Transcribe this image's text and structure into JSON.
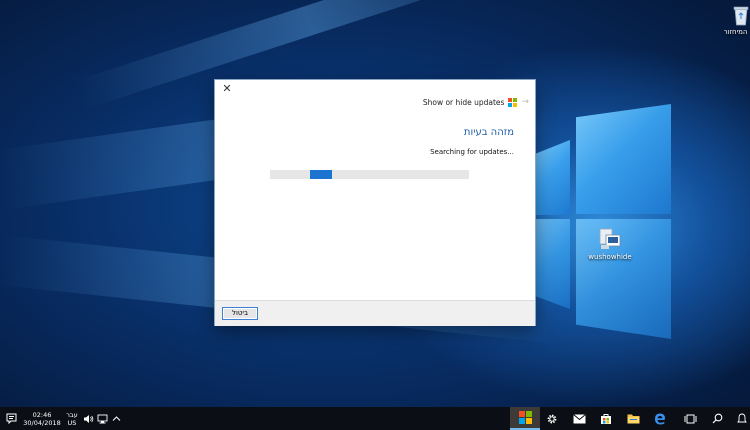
{
  "desktop": {
    "icons": [
      {
        "name": "recycle-bin",
        "label": "סל המיחזור"
      },
      {
        "name": "file-shortcut",
        "label": "wushowhide"
      }
    ]
  },
  "dialog": {
    "close_glyph": "✕",
    "show_hide_label": "Show or hide updates",
    "heading": "מזהה בעיות",
    "status": "Searching for updates...",
    "progress_fraction": 0.2,
    "cancel_label": "ביטול"
  },
  "taskbar": {
    "clock": {
      "time": "02:46",
      "date": "30/04/2018"
    },
    "language": {
      "line1": "עבר",
      "line2": "US"
    },
    "icons": [
      "notification-icon",
      "volume-icon",
      "network-icon",
      "chevron-up-icon",
      "start-button",
      "settings-icon",
      "mail-icon",
      "store-icon",
      "file-explorer-icon",
      "edge-icon",
      "task-view-icon",
      "search-icon"
    ]
  },
  "colors": {
    "accent": "#1b74d0",
    "heading": "#1f5fa8",
    "taskbar": "#0b0e14",
    "ms_red": "#f25022",
    "ms_green": "#7fba00",
    "ms_blue": "#00a4ef",
    "ms_yellow": "#ffb900"
  }
}
